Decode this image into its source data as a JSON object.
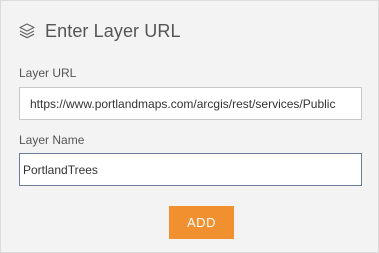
{
  "header": {
    "title": "Enter Layer URL",
    "icon": "layers-icon"
  },
  "form": {
    "url_label": "Layer URL",
    "url_value": "https://www.portlandmaps.com/arcgis/rest/services/Public",
    "name_label": "Layer Name",
    "name_value": "PortlandTrees"
  },
  "actions": {
    "add_label": "ADD"
  },
  "colors": {
    "accent": "#f0902f",
    "panel_background": "#f3f3f3",
    "focused_border": "#6a7f99"
  }
}
